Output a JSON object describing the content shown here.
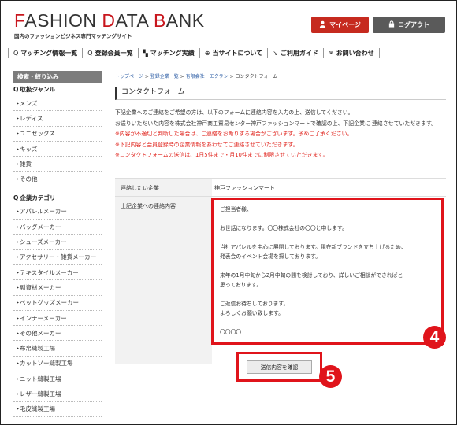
{
  "header": {
    "logo_first": "F",
    "logo_a": "ASHION ",
    "logo_d": "D",
    "logo_b": "ATA ",
    "logo_bk": "B",
    "logo_c": "ANK",
    "tagline": "国内のファッションビジネス専門マッチングサイト",
    "mypage_label": "マイページ",
    "logout_label": "ログアウト"
  },
  "nav": [
    {
      "icon": "Q",
      "label": "マッチング情報一覧"
    },
    {
      "icon": "Q",
      "label": "登録会員一覧"
    },
    {
      "icon": "▚",
      "label": "マッチング実績"
    },
    {
      "icon": "⊕",
      "label": "当サイトについて"
    },
    {
      "icon": "↘",
      "label": "ご利用ガイド"
    },
    {
      "icon": "✉",
      "label": "お問い合わせ"
    }
  ],
  "sidebar": {
    "heading": "検索・絞り込み",
    "genre_title": "取扱ジャンル",
    "genres": [
      "メンズ",
      "レディス",
      "ユニセックス",
      "キッズ",
      "雑貨",
      "その他"
    ],
    "category_title": "企業カテゴリ",
    "categories": [
      "アパレルメーカー",
      "バッグメーカー",
      "シューズメーカー",
      "アクセサリー・雑貨メーカー",
      "テキスタイルメーカー",
      "副資材メーカー",
      "ペットグッズメーカー",
      "インナーメーカー",
      "その他メーカー",
      "布帛縫製工場",
      "カットソー縫製工場",
      "ニット縫製工場",
      "レザー縫製工場",
      "毛皮縫製工場"
    ]
  },
  "breadcrumb": {
    "top": "トップページ",
    "list": "登録企業一覧",
    "company": "有限会社　エクラン",
    "current": "コンタクトフォーム",
    "sep": ">"
  },
  "page_title": "コンタクトフォーム",
  "intro": {
    "line1": "下記企業へのご連絡をご希望の方は、以下のフォームに連絡内容を入力の上、送信してください。",
    "line2": "お送りいただいた内容を株式会社神戸商工貿易センター神戸ファッションマートで確認の上、下記企業に 連絡させていただきます。",
    "notice1": "※内容が不適切と判断した場合は、ご連絡をお断りする場合がございます。予めご了承ください。",
    "notice2": "※下記内容と会員登録時の企業情報をあわせてご連絡させていただきます。",
    "notice3": "※コンタクトフォームの送信は、1日5件まで・月10件までに制限させていただきます。"
  },
  "form": {
    "company_label": "連絡したい企業",
    "company_value": "神戸ファッションマート",
    "message_label": "上記企業への連絡内容",
    "message_value": "ご担当者様、\n\nお世話になります。〇〇株式会社の〇〇と申します。\n\n当社アパレルを中心に展開しております。現在新ブランドを立ち上げるため、\n発表会のイベント会場を探しております。\n\n来年の1月中旬から2月中旬の間を検討しており、詳しいご相談ができればと\n思っております。\n\nご返信お待ちしております。\nよろしくお願い致します。\n\n〇〇〇〇"
  },
  "submit_label": "送信内容を確認",
  "badges": {
    "four": "4",
    "five": "5"
  },
  "colors": {
    "accent": "#c8161d",
    "highlight": "#e0141b",
    "logout": "#5a5a5a"
  }
}
